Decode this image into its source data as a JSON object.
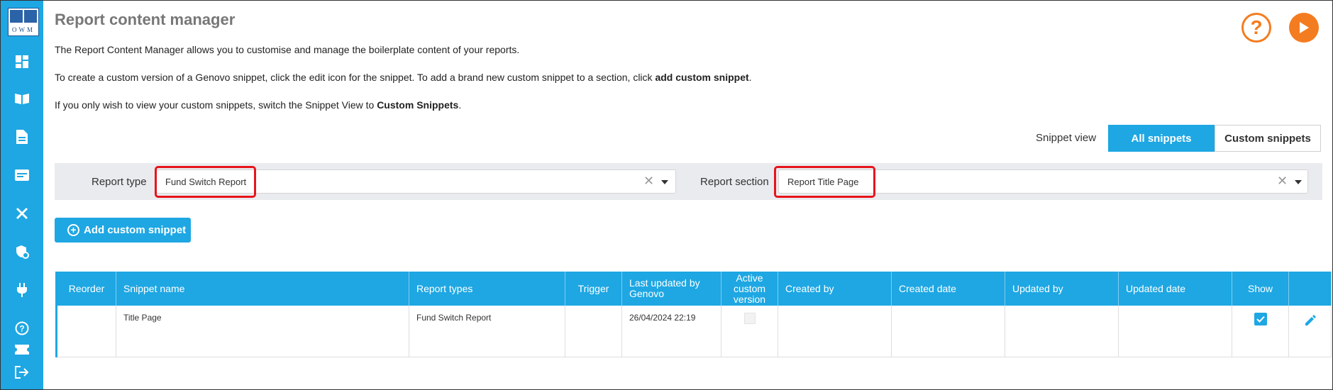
{
  "app": {
    "logo_text": "OWM",
    "title": "Report content manager",
    "help_icon": "help-circle-icon",
    "play_icon": "play-icon",
    "help_label": "?"
  },
  "sidebar": {
    "items": [
      {
        "name": "dashboard",
        "icon": "dashboard-icon"
      },
      {
        "name": "library",
        "icon": "book-icon"
      },
      {
        "name": "documents",
        "icon": "document-icon"
      },
      {
        "name": "forms",
        "icon": "form-icon"
      },
      {
        "name": "tools",
        "icon": "tools-icon"
      },
      {
        "name": "security",
        "icon": "shield-icon"
      },
      {
        "name": "plugins",
        "icon": "plug-icon"
      },
      {
        "name": "help",
        "icon": "help-icon"
      },
      {
        "name": "tickets",
        "icon": "ticket-icon"
      },
      {
        "name": "logout",
        "icon": "logout-icon"
      }
    ]
  },
  "intro": {
    "line1": "The Report Content Manager allows you to customise and manage the boilerplate content of your reports.",
    "line2_prefix": "To create a custom version of a Genovo snippet, click the edit icon for the snippet. To add a brand new custom snippet to a section, click ",
    "line2_bold": "add custom snippet",
    "line2_suffix": ".",
    "line3_prefix": "If you only wish to view your custom snippets, switch the Snippet View to ",
    "line3_bold": "Custom Snippets",
    "line3_suffix": "."
  },
  "snippet_view": {
    "label": "Snippet view",
    "options": [
      "All snippets",
      "Custom snippets"
    ],
    "selected": "All snippets"
  },
  "filters": {
    "report_type_label": "Report type",
    "report_type_value": "Fund Switch Report",
    "report_section_label": "Report section",
    "report_section_value": "Report Title Page",
    "clear_symbol": "✕"
  },
  "add_button": {
    "label": "Add custom snippet",
    "plus": "+"
  },
  "table": {
    "headers": {
      "reorder": "Reorder",
      "name": "Snippet name",
      "report_types": "Report types",
      "trigger": "Trigger",
      "last_updated_genovo": "Last updated by Genovo",
      "active_custom": "Active custom version",
      "created_by": "Created by",
      "created_date": "Created date",
      "updated_by": "Updated by",
      "updated_date": "Updated date",
      "show": "Show"
    },
    "rows": [
      {
        "reorder": "",
        "name": "Title Page",
        "report_types": "Fund Switch Report",
        "trigger": "",
        "last_updated_genovo": "26/04/2024 22:19",
        "active_custom": false,
        "created_by": "",
        "created_date": "",
        "updated_by": "",
        "updated_date": "",
        "show": true
      }
    ]
  },
  "colors": {
    "accent": "#1ea7e3",
    "orange": "#f47c20",
    "highlight": "#e8141c"
  }
}
